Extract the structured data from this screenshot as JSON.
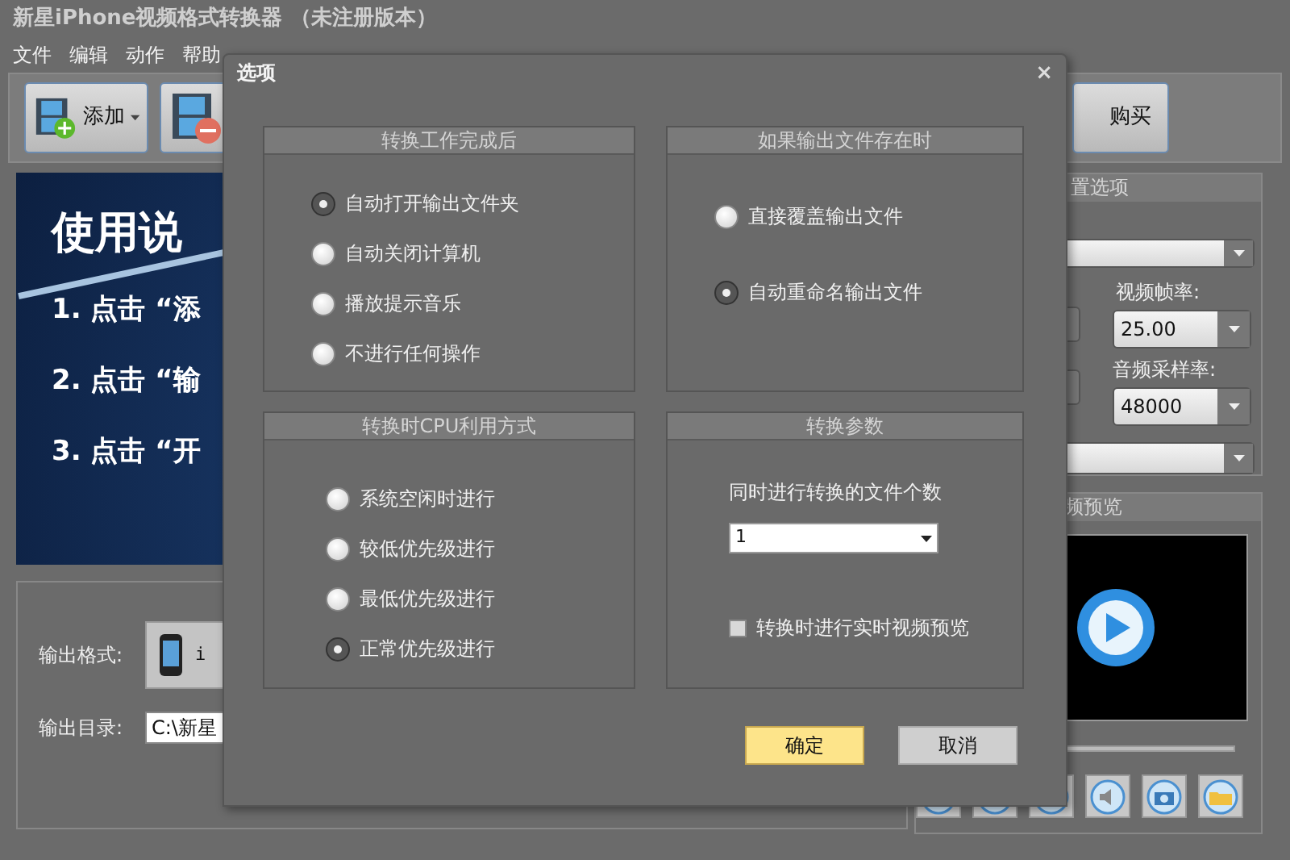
{
  "window": {
    "title": "新星iPhone视频格式转换器 （未注册版本）"
  },
  "menu": [
    "文件",
    "编辑",
    "动作",
    "帮助"
  ],
  "toolbar": [
    {
      "kind": "add",
      "label": "添加"
    },
    {
      "kind": "remove"
    },
    {
      "kind": "buy",
      "label": "购买"
    }
  ],
  "banner": {
    "title": "使用说",
    "lines": [
      "1. 点击 “添",
      "2. 点击 “输",
      "3. 点击 “开"
    ]
  },
  "output": {
    "format_label": "输出格式:",
    "format_value": "i",
    "dir_label": "输出目录:",
    "dir_value": "C:\\新星"
  },
  "settings_panel": {
    "header": "置选项",
    "frame_rate_label": "视频帧率:",
    "frame_rate": "25.00",
    "sample_rate_label": "音频采样率:",
    "sample_rate": "48000"
  },
  "preview_panel": {
    "header": "频预览"
  },
  "dialog": {
    "title": "选项",
    "close": "×",
    "groups": [
      {
        "title": "转换工作完成后",
        "options": [
          {
            "label": "自动打开输出文件夹",
            "selected": true
          },
          {
            "label": "自动关闭计算机",
            "selected": false
          },
          {
            "label": "播放提示音乐",
            "selected": false
          },
          {
            "label": "不进行任何操作",
            "selected": false
          }
        ]
      },
      {
        "title": "如果输出文件存在时",
        "options": [
          {
            "label": "直接覆盖输出文件",
            "selected": false
          },
          {
            "label": "自动重命名输出文件",
            "selected": true
          }
        ]
      },
      {
        "title": "转换时CPU利用方式",
        "options": [
          {
            "label": "系统空闲时进行",
            "selected": false
          },
          {
            "label": "较低优先级进行",
            "selected": false
          },
          {
            "label": "最低优先级进行",
            "selected": false
          },
          {
            "label": "正常优先级进行",
            "selected": true
          }
        ]
      }
    ],
    "params": {
      "title": "转换参数",
      "count_label": "同时进行转换的文件个数",
      "count_value": "1",
      "preview_label": "转换时进行实时视频预览",
      "preview_checked": false
    },
    "buttons": [
      {
        "kind": "primary",
        "label": "确定"
      },
      {
        "kind": "secondary",
        "label": "取消"
      }
    ]
  }
}
